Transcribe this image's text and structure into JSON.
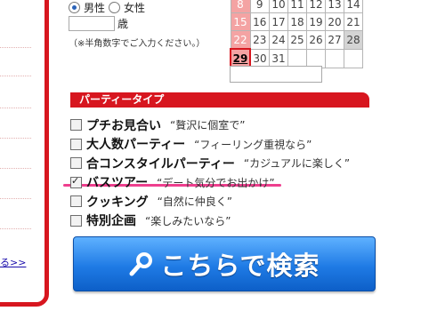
{
  "gender": {
    "options": [
      "男性",
      "女性"
    ],
    "selected": "男性"
  },
  "age": {
    "value": "",
    "unit": "歳",
    "note": "（※半角数字でご入力ください。）"
  },
  "calendar": {
    "rows": [
      [
        "8",
        "9",
        "10",
        "11",
        "12",
        "13",
        "14"
      ],
      [
        "15",
        "16",
        "17",
        "18",
        "19",
        "20",
        "21"
      ],
      [
        "22",
        "23",
        "24",
        "25",
        "26",
        "27",
        "28"
      ],
      [
        "29",
        "30",
        "31",
        "",
        "",
        "",
        ""
      ]
    ],
    "highlight_day": "29"
  },
  "calendar_input": {
    "value": ""
  },
  "party_type": {
    "header": "パーティータイプ",
    "options": [
      {
        "label": "プチお見合い",
        "desc": "“贅沢に個室で”",
        "checked": false
      },
      {
        "label": "大人数パーティー",
        "desc": "“フィーリング重視なら”",
        "checked": false
      },
      {
        "label": "合コンスタイルパーティー",
        "desc": "“カジュアルに楽しく”",
        "checked": false
      },
      {
        "label": "バスツアー",
        "desc": "“デート気分でお出かけ”",
        "checked": true
      },
      {
        "label": "クッキング",
        "desc": "“自然に仲良く”",
        "checked": false
      },
      {
        "label": "特別企画",
        "desc": "“楽しみたいなら”",
        "checked": false
      }
    ]
  },
  "left_link": "る>>",
  "search_button": {
    "label": "こちらで検索"
  },
  "colors": {
    "accent_red": "#d7161f",
    "button_blue": "#1f7be5",
    "underline_pink": "#ee3f8e"
  }
}
